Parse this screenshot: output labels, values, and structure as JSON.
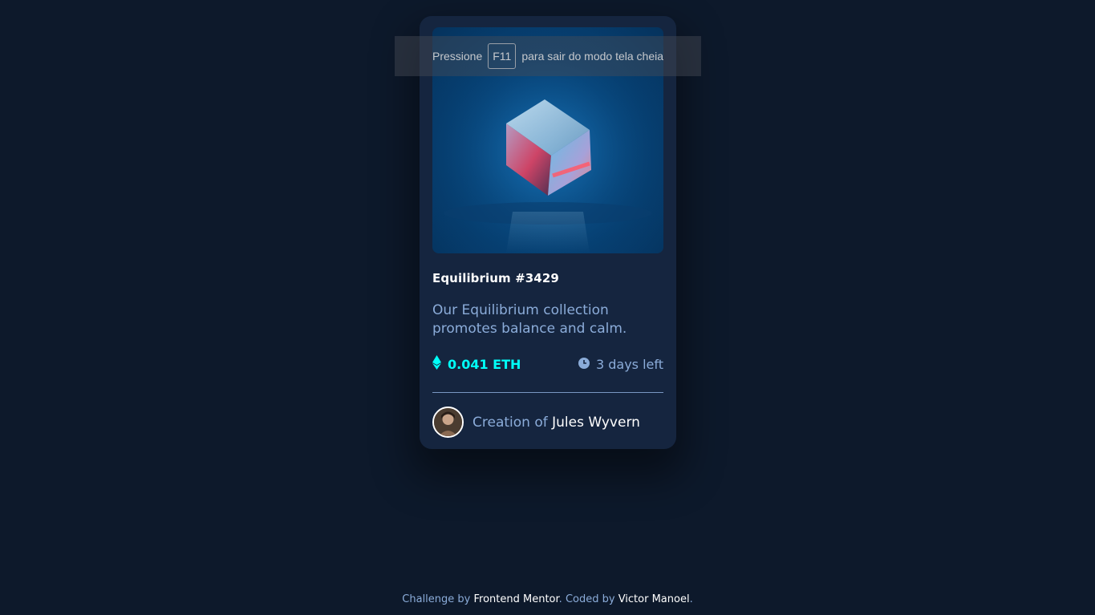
{
  "card": {
    "title": "Equilibrium #3429",
    "description": "Our Equilibrium collection promotes balance and calm.",
    "price": "0.041 ETH",
    "time_left": "3 days left",
    "creator_prefix": "Creation of ",
    "creator_name": "Jules Wyvern",
    "image_alt": "Equilibrium",
    "icons": {
      "price": "ethereum-icon",
      "time": "clock-icon"
    }
  },
  "fullscreen_notice": {
    "before": "Pressione",
    "key": "F11",
    "after": "para sair do modo tela cheia"
  },
  "footer": {
    "challenge_prefix": "Challenge by ",
    "challenge_link": "Frontend Mentor",
    "separator": ". ",
    "coded_prefix": "Coded by ",
    "coded_link": "Victor Manoel",
    "suffix": "."
  },
  "colors": {
    "background": "#0d192b",
    "card": "#15253f",
    "cyan": "#00fff8",
    "soft_blue": "#8bacd9",
    "white": "#ffffff"
  }
}
